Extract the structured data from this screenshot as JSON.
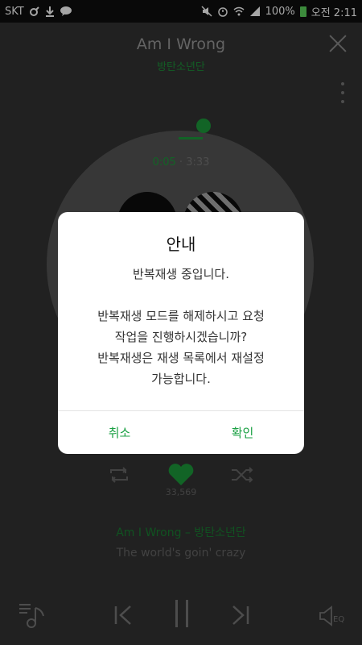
{
  "status_bar": {
    "carrier": "SKT",
    "battery_percent": "100%",
    "time": "오전 2:11",
    "icons": [
      "record-icon",
      "download-icon",
      "talk-icon",
      "mute-icon",
      "alarm-icon",
      "wifi-icon",
      "signal-icon",
      "battery-icon"
    ]
  },
  "player": {
    "song_title": "Am I Wrong",
    "artist": "방탄소년단",
    "current_time": "0:05",
    "separator": " · ",
    "total_time": "3:33",
    "like_count": "33,569",
    "now_playing_line": "Am I Wrong – 방탄소년단",
    "lyric": "The world's goin' crazy",
    "eq_label": "EQ",
    "accent_color": "#1c9a3b"
  },
  "dialog": {
    "title": "안내",
    "message_line1": "반복재생 중입니다.",
    "message_line2": "반복재생 모드를 해제하시고 요청",
    "message_line3": "작업을 진행하시겠습니까?",
    "message_line4": "반복재생은 재생 목록에서 재설정",
    "message_line5": "가능합니다.",
    "cancel_label": "취소",
    "confirm_label": "확인",
    "button_color": "#1aa043"
  }
}
